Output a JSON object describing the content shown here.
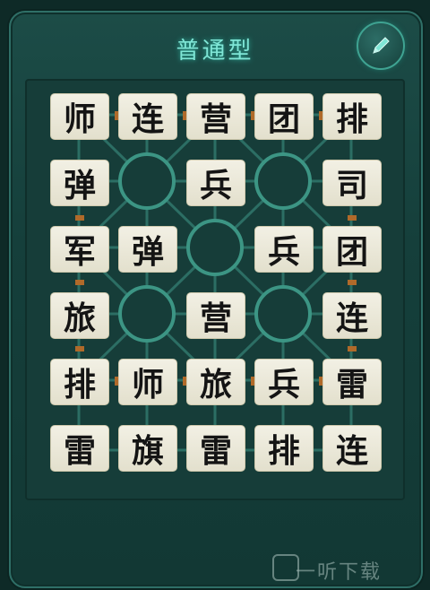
{
  "header": {
    "title": "普通型",
    "edit_icon": "pencil-icon"
  },
  "board": {
    "rows": [
      [
        "师",
        "连",
        "营",
        "团",
        "排"
      ],
      [
        "弹",
        "",
        "兵",
        "",
        "司"
      ],
      [
        "军",
        "弹",
        "",
        "兵",
        "团"
      ],
      [
        "旅",
        "",
        "营",
        "",
        "连"
      ],
      [
        "排",
        "师",
        "旅",
        "兵",
        "雷"
      ],
      [
        "雷",
        "旗",
        "雷",
        "排",
        "连"
      ]
    ]
  },
  "watermark": {
    "text": "一听下载"
  },
  "colors": {
    "panel": "#1c4c47",
    "accent": "#7fe6d6",
    "piece_base": "#5a4b9a"
  }
}
